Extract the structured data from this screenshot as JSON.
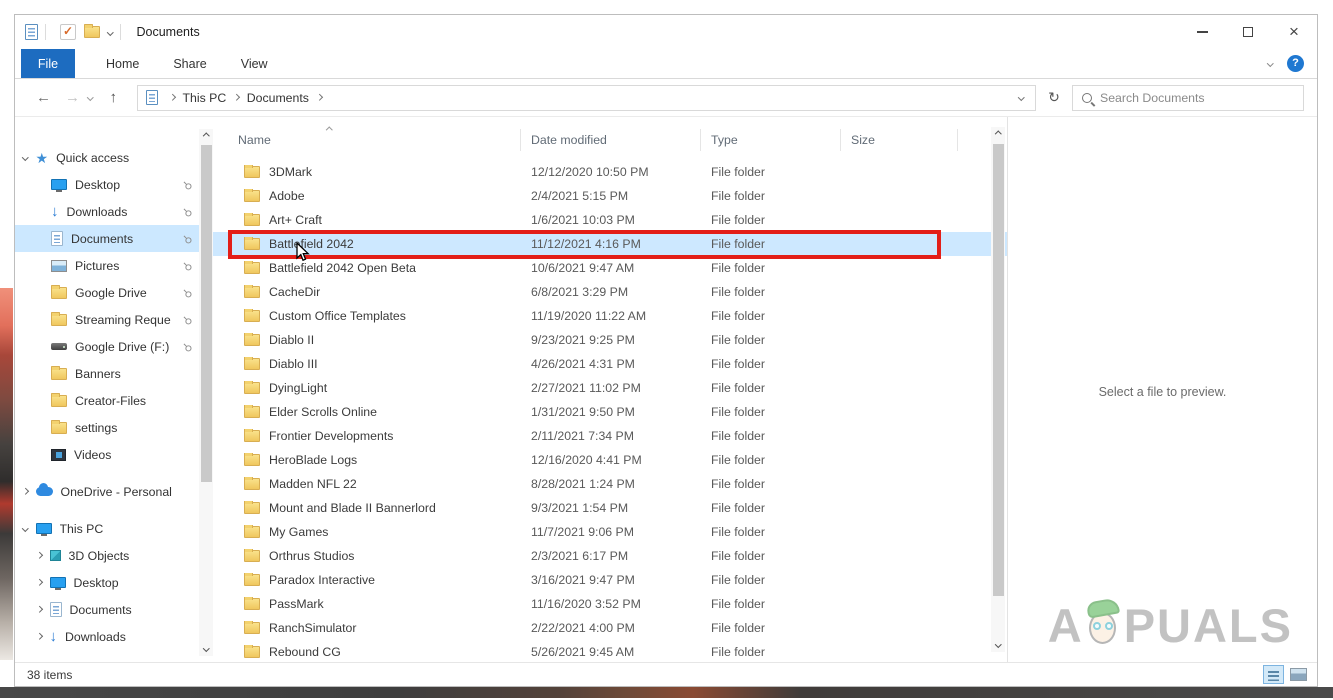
{
  "window": {
    "title": "Documents"
  },
  "icons": {
    "back": "←",
    "forward": "→",
    "up": "↑",
    "refresh": "↻",
    "close": "×",
    "help": "?",
    "check": "✓",
    "star": "★",
    "download_arrow": "↓",
    "pin": "⚲"
  },
  "tabs": {
    "file": "File",
    "home": "Home",
    "share": "Share",
    "view": "View"
  },
  "address": {
    "breadcrumb": [
      "This PC",
      "Documents"
    ],
    "search_placeholder": "Search Documents"
  },
  "sidebar": {
    "items": [
      {
        "label": "Quick access",
        "icon": "star",
        "chevron": "down",
        "depth": 0,
        "pinned": false,
        "selected": false,
        "gap": false
      },
      {
        "label": "Desktop",
        "icon": "desktop",
        "chevron": null,
        "depth": 1,
        "pinned": true,
        "selected": false,
        "gap": false
      },
      {
        "label": "Downloads",
        "icon": "downloads",
        "chevron": null,
        "depth": 1,
        "pinned": true,
        "selected": false,
        "gap": false
      },
      {
        "label": "Documents",
        "icon": "doc",
        "chevron": null,
        "depth": 1,
        "pinned": true,
        "selected": true,
        "gap": false
      },
      {
        "label": "Pictures",
        "icon": "pictures",
        "chevron": null,
        "depth": 1,
        "pinned": true,
        "selected": false,
        "gap": false
      },
      {
        "label": "Google Drive",
        "icon": "folder",
        "chevron": null,
        "depth": 1,
        "pinned": true,
        "selected": false,
        "gap": false
      },
      {
        "label": "Streaming Reque",
        "icon": "folder",
        "chevron": null,
        "depth": 1,
        "pinned": true,
        "selected": false,
        "gap": false
      },
      {
        "label": "Google Drive (F:)",
        "icon": "drive",
        "chevron": null,
        "depth": 1,
        "pinned": true,
        "selected": false,
        "gap": false
      },
      {
        "label": "Banners",
        "icon": "folder",
        "chevron": null,
        "depth": 1,
        "pinned": false,
        "selected": false,
        "gap": false
      },
      {
        "label": "Creator-Files",
        "icon": "folder",
        "chevron": null,
        "depth": 1,
        "pinned": false,
        "selected": false,
        "gap": false
      },
      {
        "label": "settings",
        "icon": "folder",
        "chevron": null,
        "depth": 1,
        "pinned": false,
        "selected": false,
        "gap": false
      },
      {
        "label": "Videos",
        "icon": "videos",
        "chevron": null,
        "depth": 1,
        "pinned": false,
        "selected": false,
        "gap": false
      },
      {
        "label": "OneDrive - Personal",
        "icon": "cloud",
        "chevron": "right",
        "depth": 0,
        "pinned": false,
        "selected": false,
        "gap": true
      },
      {
        "label": "This PC",
        "icon": "pc",
        "chevron": "down",
        "depth": 0,
        "pinned": false,
        "selected": false,
        "gap": true
      },
      {
        "label": "3D Objects",
        "icon": "cube",
        "chevron": "right",
        "depth": 1,
        "pinned": false,
        "selected": false,
        "gap": false
      },
      {
        "label": "Desktop",
        "icon": "desktop",
        "chevron": "right",
        "depth": 1,
        "pinned": false,
        "selected": false,
        "gap": false
      },
      {
        "label": "Documents",
        "icon": "doc",
        "chevron": "right",
        "depth": 1,
        "pinned": false,
        "selected": false,
        "gap": false
      },
      {
        "label": "Downloads",
        "icon": "downloads",
        "chevron": "right",
        "depth": 1,
        "pinned": false,
        "selected": false,
        "gap": false
      }
    ]
  },
  "files": {
    "columns": {
      "name": "Name",
      "date": "Date modified",
      "type": "Type",
      "size": "Size"
    },
    "rows": [
      {
        "name": "3DMark",
        "date": "12/12/2020 10:50 PM",
        "type": "File folder",
        "selected": false
      },
      {
        "name": "Adobe",
        "date": "2/4/2021 5:15 PM",
        "type": "File folder",
        "selected": false
      },
      {
        "name": "Art+ Craft",
        "date": "1/6/2021 10:03 PM",
        "type": "File folder",
        "selected": false
      },
      {
        "name": "Battlefield 2042",
        "date": "11/12/2021 4:16 PM",
        "type": "File folder",
        "selected": true
      },
      {
        "name": "Battlefield 2042 Open Beta",
        "date": "10/6/2021 9:47 AM",
        "type": "File folder",
        "selected": false
      },
      {
        "name": "CacheDir",
        "date": "6/8/2021 3:29 PM",
        "type": "File folder",
        "selected": false
      },
      {
        "name": "Custom Office Templates",
        "date": "11/19/2020 11:22 AM",
        "type": "File folder",
        "selected": false
      },
      {
        "name": "Diablo II",
        "date": "9/23/2021 9:25 PM",
        "type": "File folder",
        "selected": false
      },
      {
        "name": "Diablo III",
        "date": "4/26/2021 4:31 PM",
        "type": "File folder",
        "selected": false
      },
      {
        "name": "DyingLight",
        "date": "2/27/2021 11:02 PM",
        "type": "File folder",
        "selected": false
      },
      {
        "name": "Elder Scrolls Online",
        "date": "1/31/2021 9:50 PM",
        "type": "File folder",
        "selected": false
      },
      {
        "name": "Frontier Developments",
        "date": "2/11/2021 7:34 PM",
        "type": "File folder",
        "selected": false
      },
      {
        "name": "HeroBlade Logs",
        "date": "12/16/2020 4:41 PM",
        "type": "File folder",
        "selected": false
      },
      {
        "name": "Madden NFL 22",
        "date": "8/28/2021 1:24 PM",
        "type": "File folder",
        "selected": false
      },
      {
        "name": "Mount and Blade II Bannerlord",
        "date": "9/3/2021 1:54 PM",
        "type": "File folder",
        "selected": false
      },
      {
        "name": "My Games",
        "date": "11/7/2021 9:06 PM",
        "type": "File folder",
        "selected": false
      },
      {
        "name": "Orthrus Studios",
        "date": "2/3/2021 6:17 PM",
        "type": "File folder",
        "selected": false
      },
      {
        "name": "Paradox Interactive",
        "date": "3/16/2021 9:47 PM",
        "type": "File folder",
        "selected": false
      },
      {
        "name": "PassMark",
        "date": "11/16/2020 3:52 PM",
        "type": "File folder",
        "selected": false
      },
      {
        "name": "RanchSimulator",
        "date": "2/22/2021 4:00 PM",
        "type": "File folder",
        "selected": false
      },
      {
        "name": "Rebound CG",
        "date": "5/26/2021 9:45 AM",
        "type": "File folder",
        "selected": false
      }
    ]
  },
  "preview": {
    "message": "Select a file to preview."
  },
  "status": {
    "count": "38 items"
  },
  "watermark": {
    "left": "A",
    "right": "PUALS"
  }
}
